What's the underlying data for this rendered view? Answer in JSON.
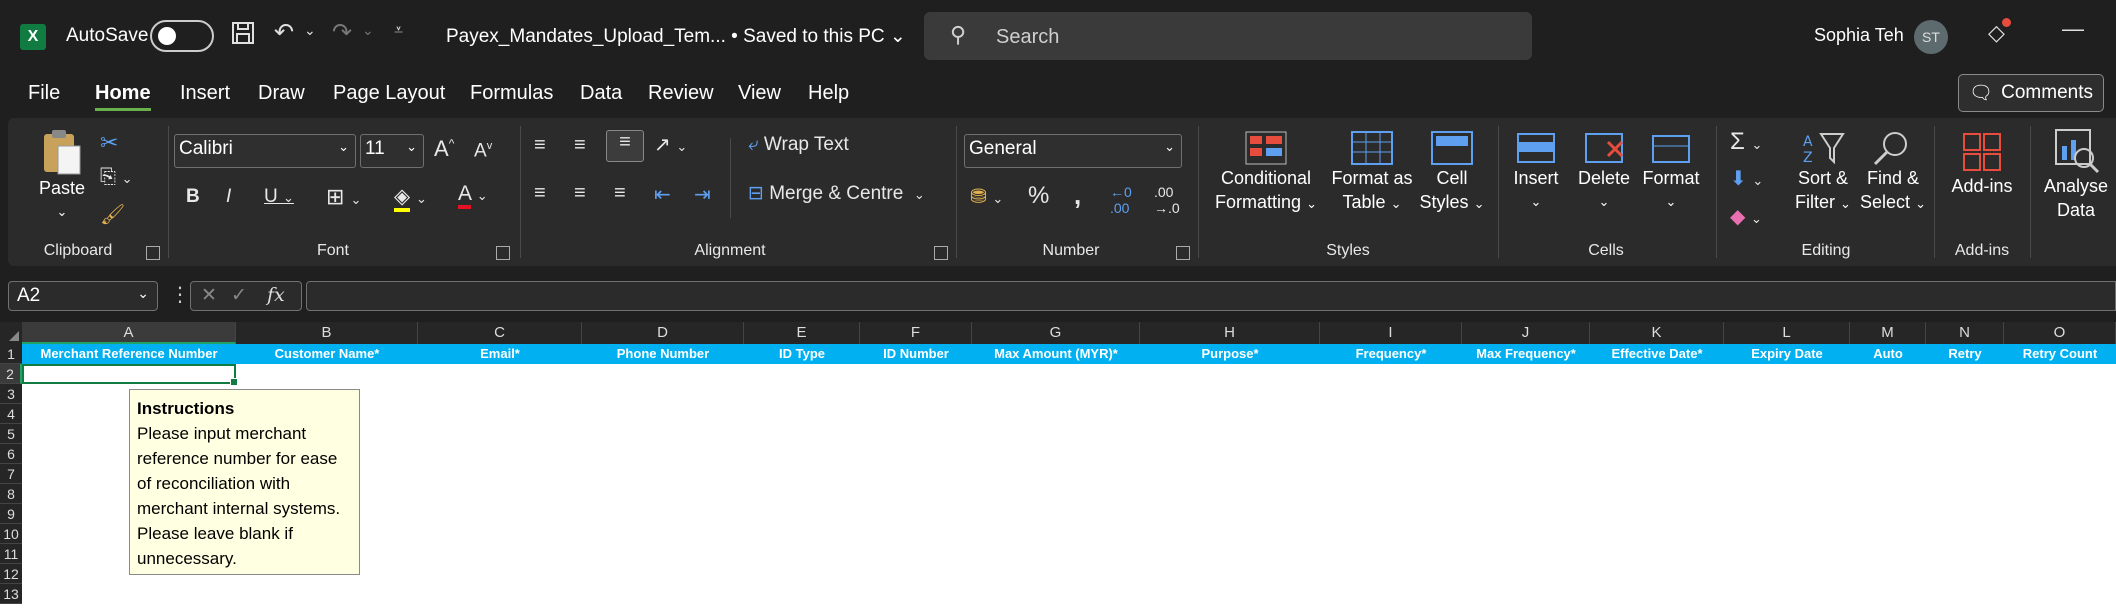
{
  "titlebar": {
    "autosave_label": "AutoSave",
    "doc_title": "Payex_Mandates_Upload_Tem...  •  Saved to this PC",
    "search_placeholder": "Search",
    "user_name": "Sophia Teh",
    "user_initials": "ST"
  },
  "menu": [
    "File",
    "Home",
    "Insert",
    "Draw",
    "Page Layout",
    "Formulas",
    "Data",
    "Review",
    "View",
    "Help"
  ],
  "comments_label": "Comments",
  "ribbon": {
    "clipboard": {
      "paste": "Paste",
      "label": "Clipboard"
    },
    "font": {
      "name": "Calibri",
      "size": "11",
      "label": "Font"
    },
    "alignment": {
      "wrap": "Wrap Text",
      "merge": "Merge & Centre",
      "label": "Alignment"
    },
    "number": {
      "format": "General",
      "label": "Number"
    },
    "styles": {
      "cond1": "Conditional",
      "cond2": "Formatting",
      "fmt1": "Format as",
      "fmt2": "Table",
      "cell1": "Cell",
      "cell2": "Styles",
      "label": "Styles"
    },
    "cells": {
      "insert": "Insert",
      "delete": "Delete",
      "format": "Format",
      "label": "Cells"
    },
    "editing": {
      "sort1": "Sort &",
      "sort2": "Filter",
      "find1": "Find &",
      "find2": "Select",
      "label": "Editing"
    },
    "addins": {
      "addins": "Add-ins",
      "label": "Add-ins"
    },
    "analyse": {
      "a1": "Analyse",
      "a2": "Data"
    }
  },
  "namebox": "A2",
  "columns": [
    {
      "letter": "A",
      "header": "Merchant Reference Number"
    },
    {
      "letter": "B",
      "header": "Customer Name*"
    },
    {
      "letter": "C",
      "header": "Email*"
    },
    {
      "letter": "D",
      "header": "Phone Number"
    },
    {
      "letter": "E",
      "header": "ID Type"
    },
    {
      "letter": "F",
      "header": "ID Number"
    },
    {
      "letter": "G",
      "header": "Max Amount (MYR)*"
    },
    {
      "letter": "H",
      "header": "Purpose*"
    },
    {
      "letter": "I",
      "header": "Frequency*"
    },
    {
      "letter": "J",
      "header": "Max Frequency*"
    },
    {
      "letter": "K",
      "header": "Effective Date*"
    },
    {
      "letter": "L",
      "header": "Expiry Date"
    },
    {
      "letter": "M",
      "header": "Auto"
    },
    {
      "letter": "N",
      "header": "Retry"
    },
    {
      "letter": "O",
      "header": "Retry Count"
    }
  ],
  "rows": [
    "1",
    "2",
    "3",
    "4",
    "5",
    "6",
    "7",
    "8",
    "9",
    "10",
    "11",
    "12",
    "13"
  ],
  "tooltip": {
    "title": "Instructions",
    "body": "Please input merchant reference number for ease of reconciliation with merchant internal systems. Please leave blank if unnecessary."
  }
}
